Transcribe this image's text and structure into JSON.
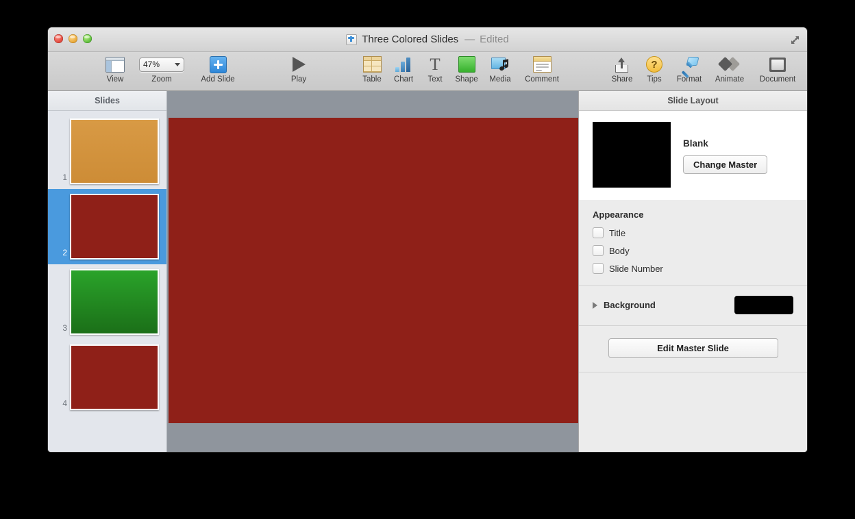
{
  "window": {
    "title_name": "Three Colored Slides",
    "title_dash": "—",
    "title_edited": "Edited",
    "doc_icon": "keynote-document-icon",
    "fullscreen_icon": "expand-arrows-icon",
    "traffic_lights": {
      "close": "close-button",
      "minimize": "minimize-button",
      "maximize": "maximize-button"
    }
  },
  "toolbar": {
    "view_label": "View",
    "zoom_value": "47%",
    "zoom_label": "Zoom",
    "add_slide_label": "Add Slide",
    "play_label": "Play",
    "table_label": "Table",
    "chart_label": "Chart",
    "text_label": "Text",
    "shape_label": "Shape",
    "media_label": "Media",
    "comment_label": "Comment",
    "share_label": "Share",
    "tips_label": "Tips",
    "tips_glyph": "?",
    "format_label": "Format",
    "animate_label": "Animate",
    "document_label": "Document"
  },
  "navigator": {
    "header": "Slides",
    "slides": [
      {
        "number": "1",
        "color": "#d3943f",
        "selected": false
      },
      {
        "number": "2",
        "color": "#8f2018",
        "selected": true
      },
      {
        "number": "3",
        "color": "#1f8a1f",
        "selected": false
      },
      {
        "number": "4",
        "color": "#8f2018",
        "selected": false
      }
    ]
  },
  "canvas": {
    "background_color": "#8f959d",
    "slide_color": "#8f2018"
  },
  "inspector": {
    "header": "Slide Layout",
    "master": {
      "name": "Blank",
      "thumb_color": "#000000",
      "change_master_label": "Change Master"
    },
    "appearance": {
      "title": "Appearance",
      "options": [
        {
          "label": "Title",
          "checked": false
        },
        {
          "label": "Body",
          "checked": false
        },
        {
          "label": "Slide Number",
          "checked": false
        }
      ]
    },
    "background": {
      "label": "Background",
      "swatch_color": "#000000"
    },
    "edit_master_label": "Edit Master Slide"
  }
}
